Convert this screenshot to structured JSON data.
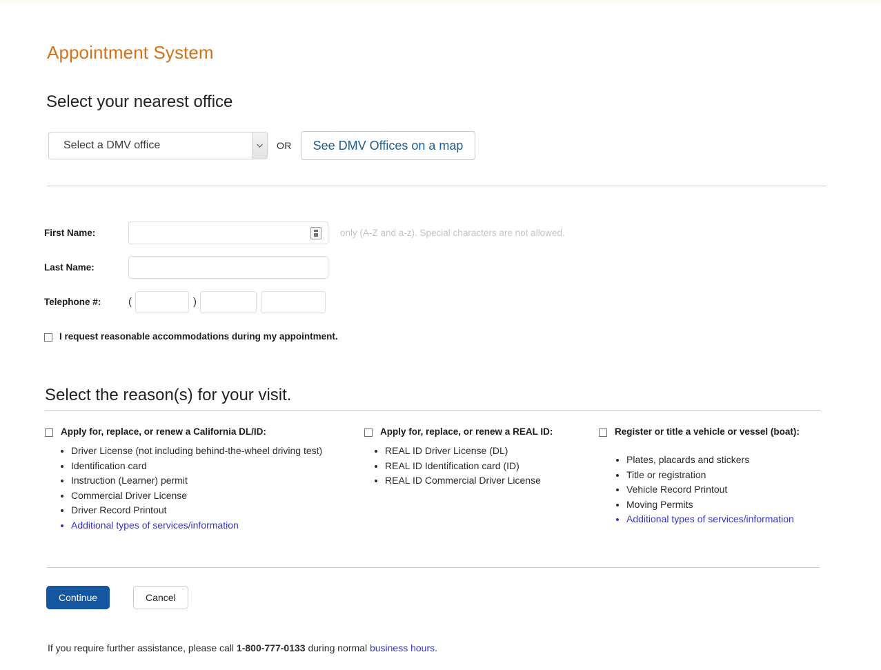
{
  "header": {
    "app_title": "Appointment System"
  },
  "office_section": {
    "heading": "Select your nearest office",
    "select_value": "Select a DMV office",
    "or_label": "OR",
    "map_button": "See DMV Offices on a map",
    "dropdown_icon": "chevron-down-icon"
  },
  "personal_info": {
    "first_name_label": "First Name:",
    "first_name_value": "",
    "first_name_hint": "only (A-Z and a-z). Special characters are not allowed.",
    "first_name_icon": "contact-card-icon",
    "last_name_label": "Last Name:",
    "last_name_value": "",
    "telephone_label": "Telephone #:",
    "paren_open": "(",
    "paren_close": ")",
    "tel_area": "",
    "tel_prefix": "",
    "tel_line": "",
    "accommodations_label": "I request reasonable accommodations during my appointment.",
    "accommodations_checked": false
  },
  "reasons_section": {
    "heading": "Select the reason(s) for your visit.",
    "columns": [
      {
        "title": "Apply for, replace, or renew a California DL/ID:",
        "checked": false,
        "items": [
          {
            "text": "Driver License (not including behind-the-wheel driving test)",
            "link": false
          },
          {
            "text": "Identification card",
            "link": false
          },
          {
            "text": "Instruction (Learner) permit",
            "link": false
          },
          {
            "text": "Commercial Driver License",
            "link": false
          },
          {
            "text": "Driver Record Printout",
            "link": false
          },
          {
            "text": "Additional types of services/information",
            "link": true
          }
        ]
      },
      {
        "title": "Apply for, replace, or renew a REAL ID:",
        "checked": false,
        "items": [
          {
            "text": "REAL ID Driver License (DL)",
            "link": false
          },
          {
            "text": "REAL ID Identification card (ID)",
            "link": false
          },
          {
            "text": "REAL ID Commercial Driver License",
            "link": false
          }
        ]
      },
      {
        "title": "Register or title a vehicle or vessel (boat):",
        "checked": false,
        "items": [
          {
            "text": "Plates, placards and stickers",
            "link": false
          },
          {
            "text": "Title or registration",
            "link": false
          },
          {
            "text": "Vehicle Record Printout",
            "link": false
          },
          {
            "text": "Moving Permits",
            "link": false
          },
          {
            "text": "Additional types of services/information",
            "link": true
          }
        ]
      }
    ]
  },
  "actions": {
    "continue_label": "Continue",
    "cancel_label": "Cancel"
  },
  "footer": {
    "prefix": "If you require further assistance, please call ",
    "phone": "1-800-777-0133",
    "middle": " during normal ",
    "link": "business hours",
    "suffix": "."
  },
  "colors": {
    "title_orange": "#d2721c",
    "primary_blue": "#14569f",
    "link_blue": "#3333cc",
    "map_link_blue": "#1a5c96",
    "hint_gray": "#c3c3c3",
    "rule_gray": "#cccccc"
  }
}
